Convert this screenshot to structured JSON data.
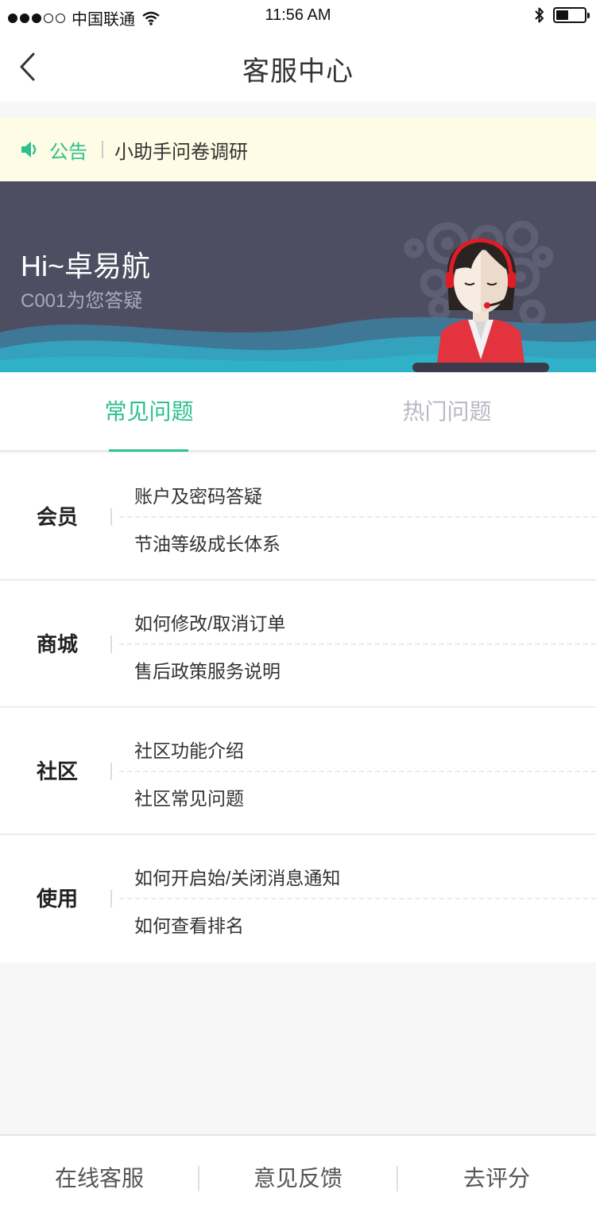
{
  "status_bar": {
    "carrier": "中国联通",
    "time": "11:56 AM",
    "signal_bars": 3,
    "battery_level": 0.45
  },
  "nav": {
    "title": "客服中心"
  },
  "notice": {
    "label": "公告",
    "text": "小助手问卷调研"
  },
  "banner": {
    "greeting": "Hi~卓易航",
    "subtitle": "C001为您答疑"
  },
  "tabs": [
    {
      "label": "常见问题",
      "active": true
    },
    {
      "label": "热门问题",
      "active": false
    }
  ],
  "faq": [
    {
      "category": "会员",
      "questions": [
        "账户及密码答疑",
        "节油等级成长体系"
      ]
    },
    {
      "category": "商城",
      "questions": [
        "如何修改/取消订单",
        "售后政策服务说明"
      ]
    },
    {
      "category": "社区",
      "questions": [
        "社区功能介绍",
        "社区常见问题"
      ]
    },
    {
      "category": "使用",
      "questions": [
        "如何开启始/关闭消息通知",
        "如何查看排名"
      ]
    }
  ],
  "bottom_bar": {
    "online_service": "在线客服",
    "feedback": "意见反馈",
    "rate": "去评分"
  },
  "colors": {
    "accent": "#2cc08e",
    "banner_bg": "#4e4e62",
    "notice_bg": "#fefce4"
  }
}
